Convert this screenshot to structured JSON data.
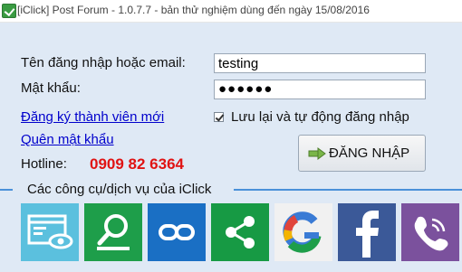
{
  "window": {
    "title": "[iClick] Post Forum - 1.0.7.7 - bản thử nghiệm dùng đến ngày 15/08/2016",
    "icon": "app-check-icon"
  },
  "login": {
    "username_label": "Tên đăng nhập hoặc email:",
    "username_value": "testing",
    "password_label": "Mật khẩu:",
    "password_value": "●●●●●●",
    "register_link": "Đăng ký thành viên mới",
    "forgot_link": "Quên mật khẩu",
    "remember_label": "Lưu lại và tự động đăng nhập",
    "remember_checked": true,
    "hotline_label": "Hotline:",
    "hotline_number": "0909 82 6364",
    "login_button": "ĐĂNG NHẬP"
  },
  "tools": {
    "section_title": "Các công cụ/dịch vụ của iClick",
    "tiles": [
      {
        "icon": "browser-eye-icon",
        "color": "#5bc0de"
      },
      {
        "icon": "search-magnifier-icon",
        "color": "#1e9e4a"
      },
      {
        "icon": "link-chain-icon",
        "color": "#1a6fc4"
      },
      {
        "icon": "share-icon",
        "color": "#179a44"
      },
      {
        "icon": "google-icon",
        "color": "#ffffff"
      },
      {
        "icon": "facebook-icon",
        "color": "#3b5998"
      },
      {
        "icon": "viber-icon",
        "color": "#7b519d"
      }
    ]
  },
  "colors": {
    "background": "#dfe9f5",
    "accent_line": "#4a90d9",
    "hotline": "#e01313",
    "link": "#0000cc"
  }
}
